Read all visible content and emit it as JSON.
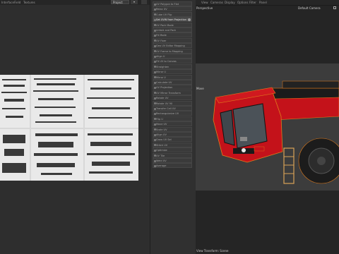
{
  "menubar": {
    "items": [
      "Interface",
      "Field",
      "Textures"
    ]
  },
  "uv_panel": {
    "view_select": "Project"
  },
  "command_palette": {
    "items": [
      {
        "label": "UV Polygon to Flat",
        "highlight": false
      },
      {
        "label": "Relax UV",
        "highlight": false
      },
      {
        "label": "Cube UV Flip",
        "highlight": false
      },
      {
        "label": "Set UVW from Projection",
        "highlight": true
      },
      {
        "label": "UV Pack Mode",
        "highlight": false
      },
      {
        "label": "Unfold and Pack",
        "highlight": false
      },
      {
        "label": "Fit Mode",
        "highlight": false
      },
      {
        "label": "UV Fixer",
        "highlight": false
      },
      {
        "label": "Geo UV Editor Mapping",
        "highlight": false
      },
      {
        "label": "UV Frame to Mapping",
        "highlight": false
      },
      {
        "label": "Align U",
        "highlight": false
      },
      {
        "label": "Fit UV to Canvas",
        "highlight": false
      },
      {
        "label": "Straighten",
        "highlight": false
      },
      {
        "label": "Mirror U",
        "highlight": false
      },
      {
        "label": "Mirror V",
        "highlight": false
      },
      {
        "label": "Calculate UV",
        "highlight": false
      },
      {
        "label": "UV Projection",
        "highlight": false
      },
      {
        "label": "UV Mirror Transform",
        "highlight": false
      },
      {
        "label": "Rotate UV",
        "highlight": false
      },
      {
        "label": "Rotate UV 90",
        "highlight": false
      },
      {
        "label": "Transfer Cell UV",
        "highlight": false
      },
      {
        "label": "Rectangularize UV",
        "highlight": false
      },
      {
        "label": "Flip U",
        "highlight": false
      },
      {
        "label": "Move UV",
        "highlight": false
      },
      {
        "label": "Scale UV",
        "highlight": false
      },
      {
        "label": "Align UV",
        "highlight": false
      },
      {
        "label": "Grow UV Sel",
        "highlight": false
      },
      {
        "label": "Stitch UV",
        "highlight": false
      },
      {
        "label": "Optimize",
        "highlight": false
      },
      {
        "label": "UV Tile",
        "highlight": false
      },
      {
        "label": "Weld UV",
        "highlight": false
      },
      {
        "label": "Average",
        "highlight": false
      }
    ]
  },
  "viewport": {
    "menu": [
      "View",
      "Cameras",
      "Display",
      "Options",
      "Filter",
      "Panel"
    ],
    "perspective_label": "Perspective",
    "camera_label": "Default Camera",
    "move_label": "Move",
    "status_label": "View Transform: Scene"
  },
  "colors": {
    "model_red": "#c4121a",
    "selection_orange": "#e07b1c",
    "background": "#2b2b2b"
  }
}
